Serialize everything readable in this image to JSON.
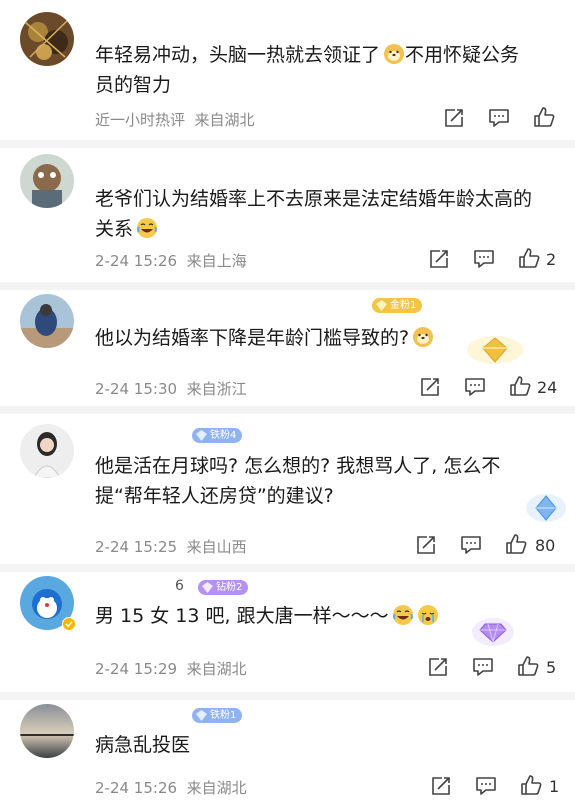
{
  "comments": [
    {
      "name": "",
      "badge": "",
      "text_lines": [
        "年轻易冲动，头脑一热就去领证了",
        "不用怀疑公务",
        "员的智力"
      ],
      "meta": "近一小时热评  来自湖北",
      "likes": "",
      "emojis": [
        "doge-emoji"
      ]
    },
    {
      "name": "",
      "badge": "",
      "text_lines": [
        "老爷们认为结婚率上不去原来是法定结婚年龄太高的",
        "关系"
      ],
      "meta": "2-24 15:26  来自上海",
      "likes": "2",
      "emojis": [
        "laugh-cry-emoji"
      ]
    },
    {
      "name": "",
      "badge": "金粉1",
      "text_lines": [
        "他以为结婚率下降是年龄门槛导致的?"
      ],
      "meta": "2-24 15:30  来自浙江",
      "likes": "24",
      "emojis": [
        "doge-emoji"
      ]
    },
    {
      "name": "",
      "badge": "铁粉4",
      "text_lines": [
        "他是活在月球吗? 怎么想的? 我想骂人了, 怎么不",
        "提“帮年轻人还房贷”的建议?"
      ],
      "meta": "2-24 15:25  来自山西",
      "likes": "80",
      "emojis": []
    },
    {
      "name": "6",
      "badge": "钻粉2",
      "text_lines": [
        "男 15 女 13 吧, 跟大唐一样～～～"
      ],
      "meta": "2-24 15:29  来自湖北",
      "likes": "5",
      "emojis": [
        "laugh-cry-emoji",
        "cry-emoji"
      ]
    },
    {
      "name": "",
      "badge": "铁粉1",
      "text_lines": [
        "病急乱投医"
      ],
      "meta": "2-24 15:26  来自湖北",
      "likes": "1",
      "emojis": []
    }
  ],
  "colors": {
    "gold_badge": "#f4c542",
    "iron_badge": "#8fb3f0",
    "diamond_badge": "#b392f0",
    "meta_gray": "#8a8a8a",
    "divider": "#f4f4f4"
  },
  "icons": {
    "share": "share-icon",
    "comment": "comment-icon",
    "like": "thumbs-up-icon"
  }
}
